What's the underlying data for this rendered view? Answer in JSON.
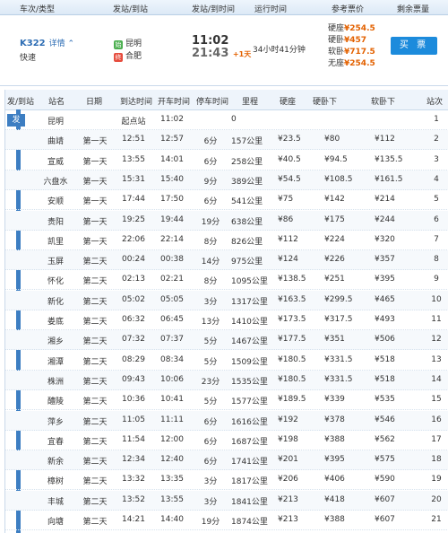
{
  "header": {
    "train_type": "车次/类型",
    "from_to": "发站/到站",
    "dep_arr": "发站/到时间",
    "duration": "运行时间",
    "ref_price": "参考票价",
    "remaining": "剩余票量"
  },
  "train": {
    "number": "K322",
    "detail": "详情",
    "type": "快速",
    "from_badge": "始",
    "from": "昆明",
    "to_badge": "终",
    "to": "合肥",
    "dep_time": "11:02",
    "arr_time": "21:43",
    "arr_plus": "+1天",
    "duration": "34小时41分钟",
    "fares": [
      {
        "label": "硬座",
        "price": "¥254.5"
      },
      {
        "label": "硬卧",
        "price": "¥457"
      },
      {
        "label": "软卧",
        "price": "¥717.5"
      },
      {
        "label": "无座",
        "price": "¥254.5"
      }
    ],
    "buy_label": "买 票"
  },
  "table": {
    "headers": [
      "发/到站",
      "站名",
      "日期",
      "到达时间",
      "开车时间",
      "停车时间",
      "里程",
      "硬座",
      "硬卧下",
      "软卧下",
      "站次"
    ],
    "fa_marker": "发",
    "rows": [
      [
        "昆明",
        "",
        "起点站",
        "11:02",
        "",
        "0",
        "",
        "",
        "",
        "1"
      ],
      [
        "曲靖",
        "第一天",
        "12:51",
        "12:57",
        "6分",
        "157公里",
        "¥23.5",
        "¥80",
        "¥112",
        "2"
      ],
      [
        "宣威",
        "第一天",
        "13:55",
        "14:01",
        "6分",
        "258公里",
        "¥40.5",
        "¥94.5",
        "¥135.5",
        "3"
      ],
      [
        "六盘水",
        "第一天",
        "15:31",
        "15:40",
        "9分",
        "389公里",
        "¥54.5",
        "¥108.5",
        "¥161.5",
        "4"
      ],
      [
        "安顺",
        "第一天",
        "17:44",
        "17:50",
        "6分",
        "541公里",
        "¥75",
        "¥142",
        "¥214",
        "5"
      ],
      [
        "贵阳",
        "第一天",
        "19:25",
        "19:44",
        "19分",
        "638公里",
        "¥86",
        "¥175",
        "¥244",
        "6"
      ],
      [
        "凯里",
        "第一天",
        "22:06",
        "22:14",
        "8分",
        "826公里",
        "¥112",
        "¥224",
        "¥320",
        "7"
      ],
      [
        "玉屏",
        "第二天",
        "00:24",
        "00:38",
        "14分",
        "975公里",
        "¥124",
        "¥226",
        "¥357",
        "8"
      ],
      [
        "怀化",
        "第二天",
        "02:13",
        "02:21",
        "8分",
        "1095公里",
        "¥138.5",
        "¥251",
        "¥395",
        "9"
      ],
      [
        "新化",
        "第二天",
        "05:02",
        "05:05",
        "3分",
        "1317公里",
        "¥163.5",
        "¥299.5",
        "¥465",
        "10"
      ],
      [
        "娄底",
        "第二天",
        "06:32",
        "06:45",
        "13分",
        "1410公里",
        "¥173.5",
        "¥317.5",
        "¥493",
        "11"
      ],
      [
        "湘乡",
        "第二天",
        "07:32",
        "07:37",
        "5分",
        "1467公里",
        "¥177.5",
        "¥351",
        "¥506",
        "12"
      ],
      [
        "湘潭",
        "第二天",
        "08:29",
        "08:34",
        "5分",
        "1509公里",
        "¥180.5",
        "¥331.5",
        "¥518",
        "13"
      ],
      [
        "株洲",
        "第二天",
        "09:43",
        "10:06",
        "23分",
        "1535公里",
        "¥180.5",
        "¥331.5",
        "¥518",
        "14"
      ],
      [
        "醴陵",
        "第二天",
        "10:36",
        "10:41",
        "5分",
        "1577公里",
        "¥189.5",
        "¥339",
        "¥535",
        "15"
      ],
      [
        "萍乡",
        "第二天",
        "11:05",
        "11:11",
        "6分",
        "1616公里",
        "¥192",
        "¥378",
        "¥546",
        "16"
      ],
      [
        "宜春",
        "第二天",
        "11:54",
        "12:00",
        "6分",
        "1687公里",
        "¥198",
        "¥388",
        "¥562",
        "17"
      ],
      [
        "新余",
        "第二天",
        "12:34",
        "12:40",
        "6分",
        "1741公里",
        "¥201",
        "¥395",
        "¥575",
        "18"
      ],
      [
        "樟树",
        "第二天",
        "13:32",
        "13:35",
        "3分",
        "1817公里",
        "¥206",
        "¥406",
        "¥590",
        "19"
      ],
      [
        "丰城",
        "第二天",
        "13:52",
        "13:55",
        "3分",
        "1841公里",
        "¥213",
        "¥418",
        "¥607",
        "20"
      ],
      [
        "向塘",
        "第二天",
        "14:21",
        "14:40",
        "19分",
        "1874公里",
        "¥213",
        "¥388",
        "¥607",
        "21"
      ]
    ]
  }
}
